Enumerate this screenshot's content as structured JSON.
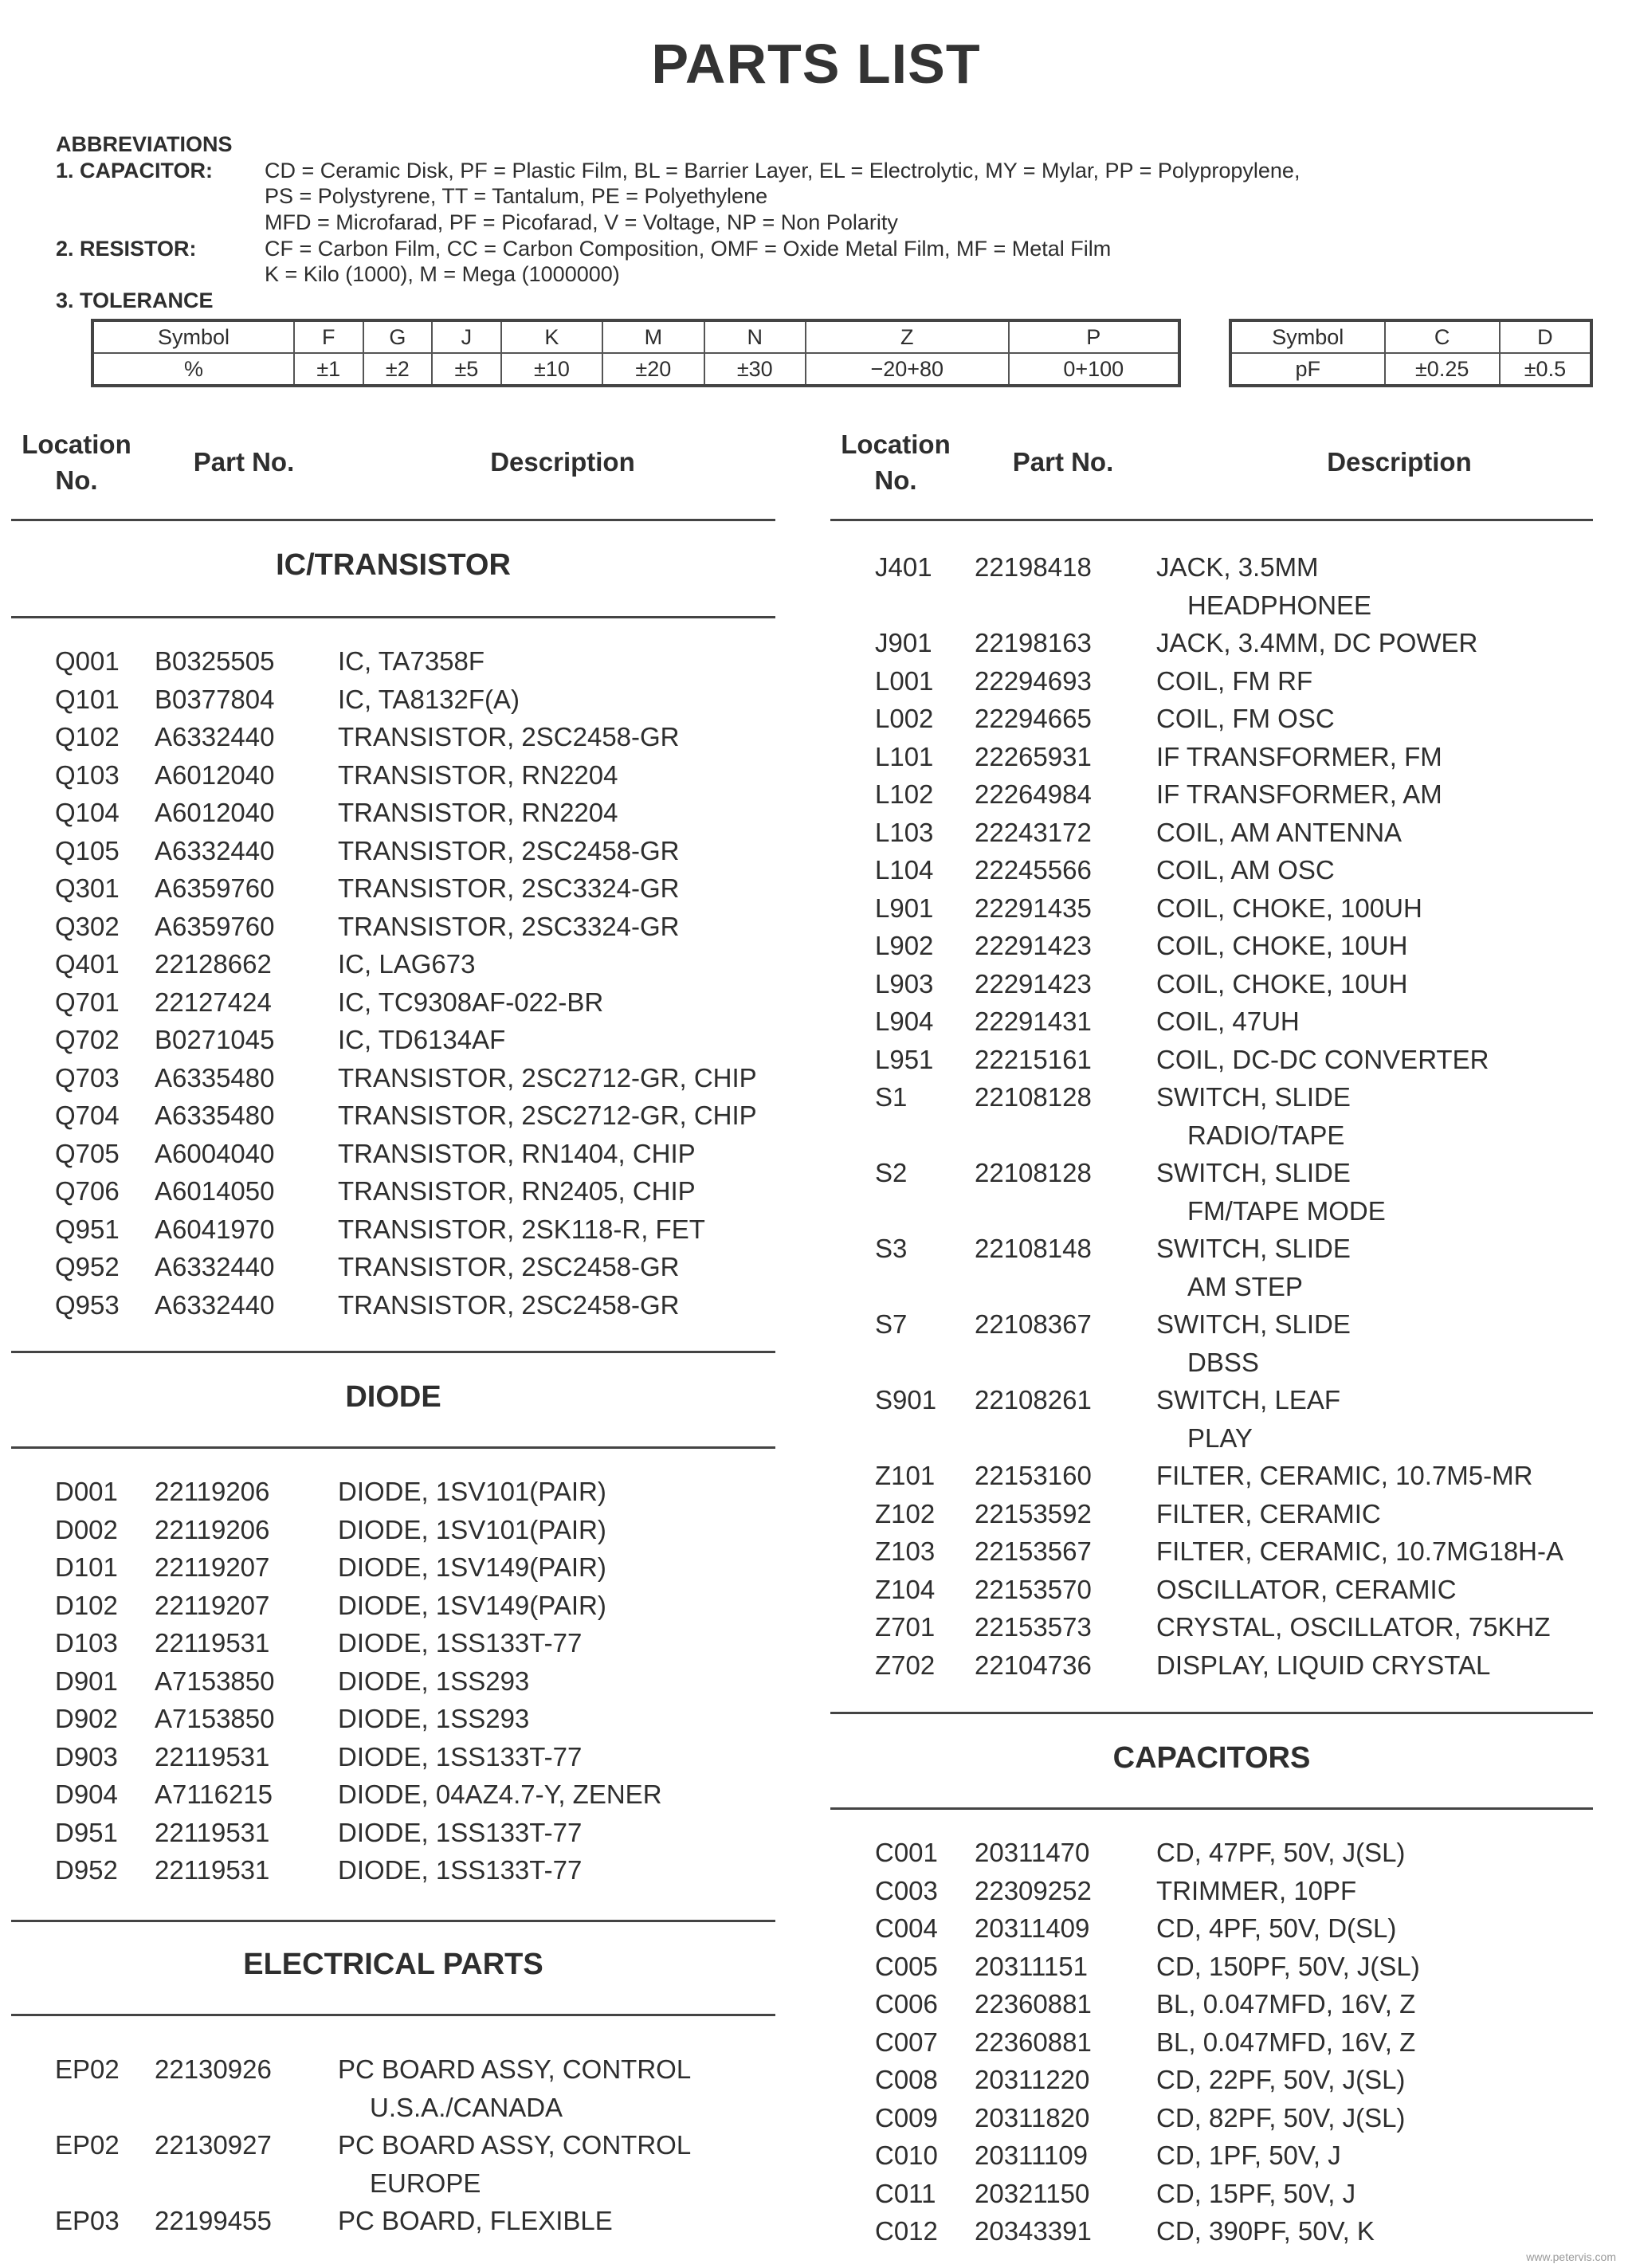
{
  "title": "PARTS LIST",
  "abbreviations": {
    "heading": "ABBREVIATIONS",
    "capacitor_label": "1.  CAPACITOR:",
    "capacitor_lines": [
      "CD = Ceramic Disk, PF = Plastic Film, BL = Barrier Layer, EL = Electrolytic, MY = Mylar, PP = Polypropylene,",
      "PS = Polystyrene, TT = Tantalum, PE = Polyethylene",
      "MFD = Microfarad, PF = Picofarad, V = Voltage, NP = Non Polarity"
    ],
    "resistor_label": "2.  RESISTOR:",
    "resistor_lines": [
      "CF = Carbon Film, CC = Carbon Composition, OMF = Oxide Metal Film, MF = Metal Film",
      "K = Kilo (1000), M = Mega (1000000)"
    ],
    "tolerance_label": "3.  TOLERANCE"
  },
  "tolerance_table": {
    "symbols": [
      "Symbol",
      "F",
      "G",
      "J",
      "K",
      "M",
      "N",
      "Z",
      "P"
    ],
    "values": [
      "%",
      "±1",
      "±2",
      "±5",
      "±10",
      "±20",
      "±30",
      "−20+80",
      "0+100"
    ]
  },
  "tolerance_table_pf": {
    "symbols": [
      "Symbol",
      "C",
      "D"
    ],
    "values": [
      "pF",
      "±0.25",
      "±0.5"
    ]
  },
  "column_headers": {
    "location": "Location",
    "location2": "No.",
    "part": "Part No.",
    "description": "Description"
  },
  "left_sections": [
    {
      "heading": "IC/TRANSISTOR",
      "rows": [
        [
          "Q001",
          "B0325505",
          "IC, TA7358F"
        ],
        [
          "Q101",
          "B0377804",
          "IC, TA8132F(A)"
        ],
        [
          "Q102",
          "A6332440",
          "TRANSISTOR, 2SC2458-GR"
        ],
        [
          "Q103",
          "A6012040",
          "TRANSISTOR, RN2204"
        ],
        [
          "Q104",
          "A6012040",
          "TRANSISTOR, RN2204"
        ],
        [
          "Q105",
          "A6332440",
          "TRANSISTOR, 2SC2458-GR"
        ],
        [
          "Q301",
          "A6359760",
          "TRANSISTOR, 2SC3324-GR"
        ],
        [
          "Q302",
          "A6359760",
          "TRANSISTOR, 2SC3324-GR"
        ],
        [
          "Q401",
          "22128662",
          "IC, LAG673"
        ],
        [
          "Q701",
          "22127424",
          "IC, TC9308AF-022-BR"
        ],
        [
          "Q702",
          "B0271045",
          "IC, TD6134AF"
        ],
        [
          "Q703",
          "A6335480",
          "TRANSISTOR, 2SC2712-GR, CHIP"
        ],
        [
          "Q704",
          "A6335480",
          "TRANSISTOR, 2SC2712-GR, CHIP"
        ],
        [
          "Q705",
          "A6004040",
          "TRANSISTOR, RN1404, CHIP"
        ],
        [
          "Q706",
          "A6014050",
          "TRANSISTOR, RN2405, CHIP"
        ],
        [
          "Q951",
          "A6041970",
          "TRANSISTOR, 2SK118-R, FET"
        ],
        [
          "Q952",
          "A6332440",
          "TRANSISTOR, 2SC2458-GR"
        ],
        [
          "Q953",
          "A6332440",
          "TRANSISTOR, 2SC2458-GR"
        ]
      ]
    },
    {
      "heading": "DIODE",
      "rows": [
        [
          "D001",
          "22119206",
          "DIODE, 1SV101(PAIR)"
        ],
        [
          "D002",
          "22119206",
          "DIODE, 1SV101(PAIR)"
        ],
        [
          "D101",
          "22119207",
          "DIODE, 1SV149(PAIR)"
        ],
        [
          "D102",
          "22119207",
          "DIODE, 1SV149(PAIR)"
        ],
        [
          "D103",
          "22119531",
          "DIODE, 1SS133T-77"
        ],
        [
          "D901",
          "A7153850",
          "DIODE, 1SS293"
        ],
        [
          "D902",
          "A7153850",
          "DIODE, 1SS293"
        ],
        [
          "D903",
          "22119531",
          "DIODE, 1SS133T-77"
        ],
        [
          "D904",
          "A7116215",
          "DIODE, 04AZ4.7-Y, ZENER"
        ],
        [
          "D951",
          "22119531",
          "DIODE, 1SS133T-77"
        ],
        [
          "D952",
          "22119531",
          "DIODE, 1SS133T-77"
        ]
      ]
    },
    {
      "heading": "ELECTRICAL PARTS",
      "rows": [
        [
          "EP02",
          "22130926",
          "PC BOARD ASSY, CONTROL",
          "U.S.A./CANADA"
        ],
        [
          "EP02",
          "22130927",
          "PC BOARD ASSY, CONTROL",
          "EUROPE"
        ],
        [
          "EP03",
          "22199455",
          "PC BOARD, FLEXIBLE"
        ]
      ]
    }
  ],
  "right_sections": [
    {
      "heading": "",
      "rows": [
        [
          "J401",
          "22198418",
          "JACK, 3.5MM",
          "HEADPHONEE"
        ],
        [
          "J901",
          "22198163",
          "JACK, 3.4MM, DC POWER"
        ],
        [
          "L001",
          "22294693",
          "COIL, FM RF"
        ],
        [
          "L002",
          "22294665",
          "COIL, FM OSC"
        ],
        [
          "L101",
          "22265931",
          "IF TRANSFORMER, FM"
        ],
        [
          "L102",
          "22264984",
          "IF TRANSFORMER, AM"
        ],
        [
          "L103",
          "22243172",
          "COIL, AM ANTENNA"
        ],
        [
          "L104",
          "22245566",
          "COIL, AM OSC"
        ],
        [
          "L901",
          "22291435",
          "COIL, CHOKE, 100UH"
        ],
        [
          "L902",
          "22291423",
          "COIL, CHOKE, 10UH"
        ],
        [
          "L903",
          "22291423",
          "COIL, CHOKE, 10UH"
        ],
        [
          "L904",
          "22291431",
          "COIL, 47UH"
        ],
        [
          "L951",
          "22215161",
          "COIL, DC-DC CONVERTER"
        ],
        [
          "S1",
          "22108128",
          "SWITCH, SLIDE",
          "RADIO/TAPE"
        ],
        [
          "S2",
          "22108128",
          "SWITCH, SLIDE",
          "FM/TAPE MODE"
        ],
        [
          "S3",
          "22108148",
          "SWITCH, SLIDE",
          "AM STEP"
        ],
        [
          "S7",
          "22108367",
          "SWITCH, SLIDE",
          "DBSS"
        ],
        [
          "S901",
          "22108261",
          "SWITCH, LEAF",
          "PLAY"
        ],
        [
          "Z101",
          "22153160",
          "FILTER, CERAMIC, 10.7M5-MR"
        ],
        [
          "Z102",
          "22153592",
          "FILTER, CERAMIC"
        ],
        [
          "Z103",
          "22153567",
          "FILTER, CERAMIC, 10.7MG18H-A"
        ],
        [
          "Z104",
          "22153570",
          "OSCILLATOR, CERAMIC"
        ],
        [
          "Z701",
          "22153573",
          "CRYSTAL, OSCILLATOR, 75KHZ"
        ],
        [
          "Z702",
          "22104736",
          "DISPLAY, LIQUID CRYSTAL"
        ]
      ]
    },
    {
      "heading": "CAPACITORS",
      "rows": [
        [
          "C001",
          "20311470",
          "CD, 47PF, 50V, J(SL)"
        ],
        [
          "C003",
          "22309252",
          "TRIMMER, 10PF"
        ],
        [
          "C004",
          "20311409",
          "CD, 4PF, 50V, D(SL)"
        ],
        [
          "C005",
          "20311151",
          "CD, 150PF, 50V, J(SL)"
        ],
        [
          "C006",
          "22360881",
          "BL, 0.047MFD, 16V, Z"
        ],
        [
          "C007",
          "22360881",
          "BL, 0.047MFD, 16V, Z"
        ],
        [
          "C008",
          "20311220",
          "CD, 22PF, 50V, J(SL)"
        ],
        [
          "C009",
          "20311820",
          "CD, 82PF, 50V, J(SL)"
        ],
        [
          "C010",
          "20311109",
          "CD, 1PF, 50V, J"
        ],
        [
          "C011",
          "20321150",
          "CD, 15PF, 50V, J"
        ],
        [
          "C012",
          "20343391",
          "CD, 390PF, 50V, K"
        ]
      ]
    }
  ],
  "watermark": "www.petervis.com"
}
